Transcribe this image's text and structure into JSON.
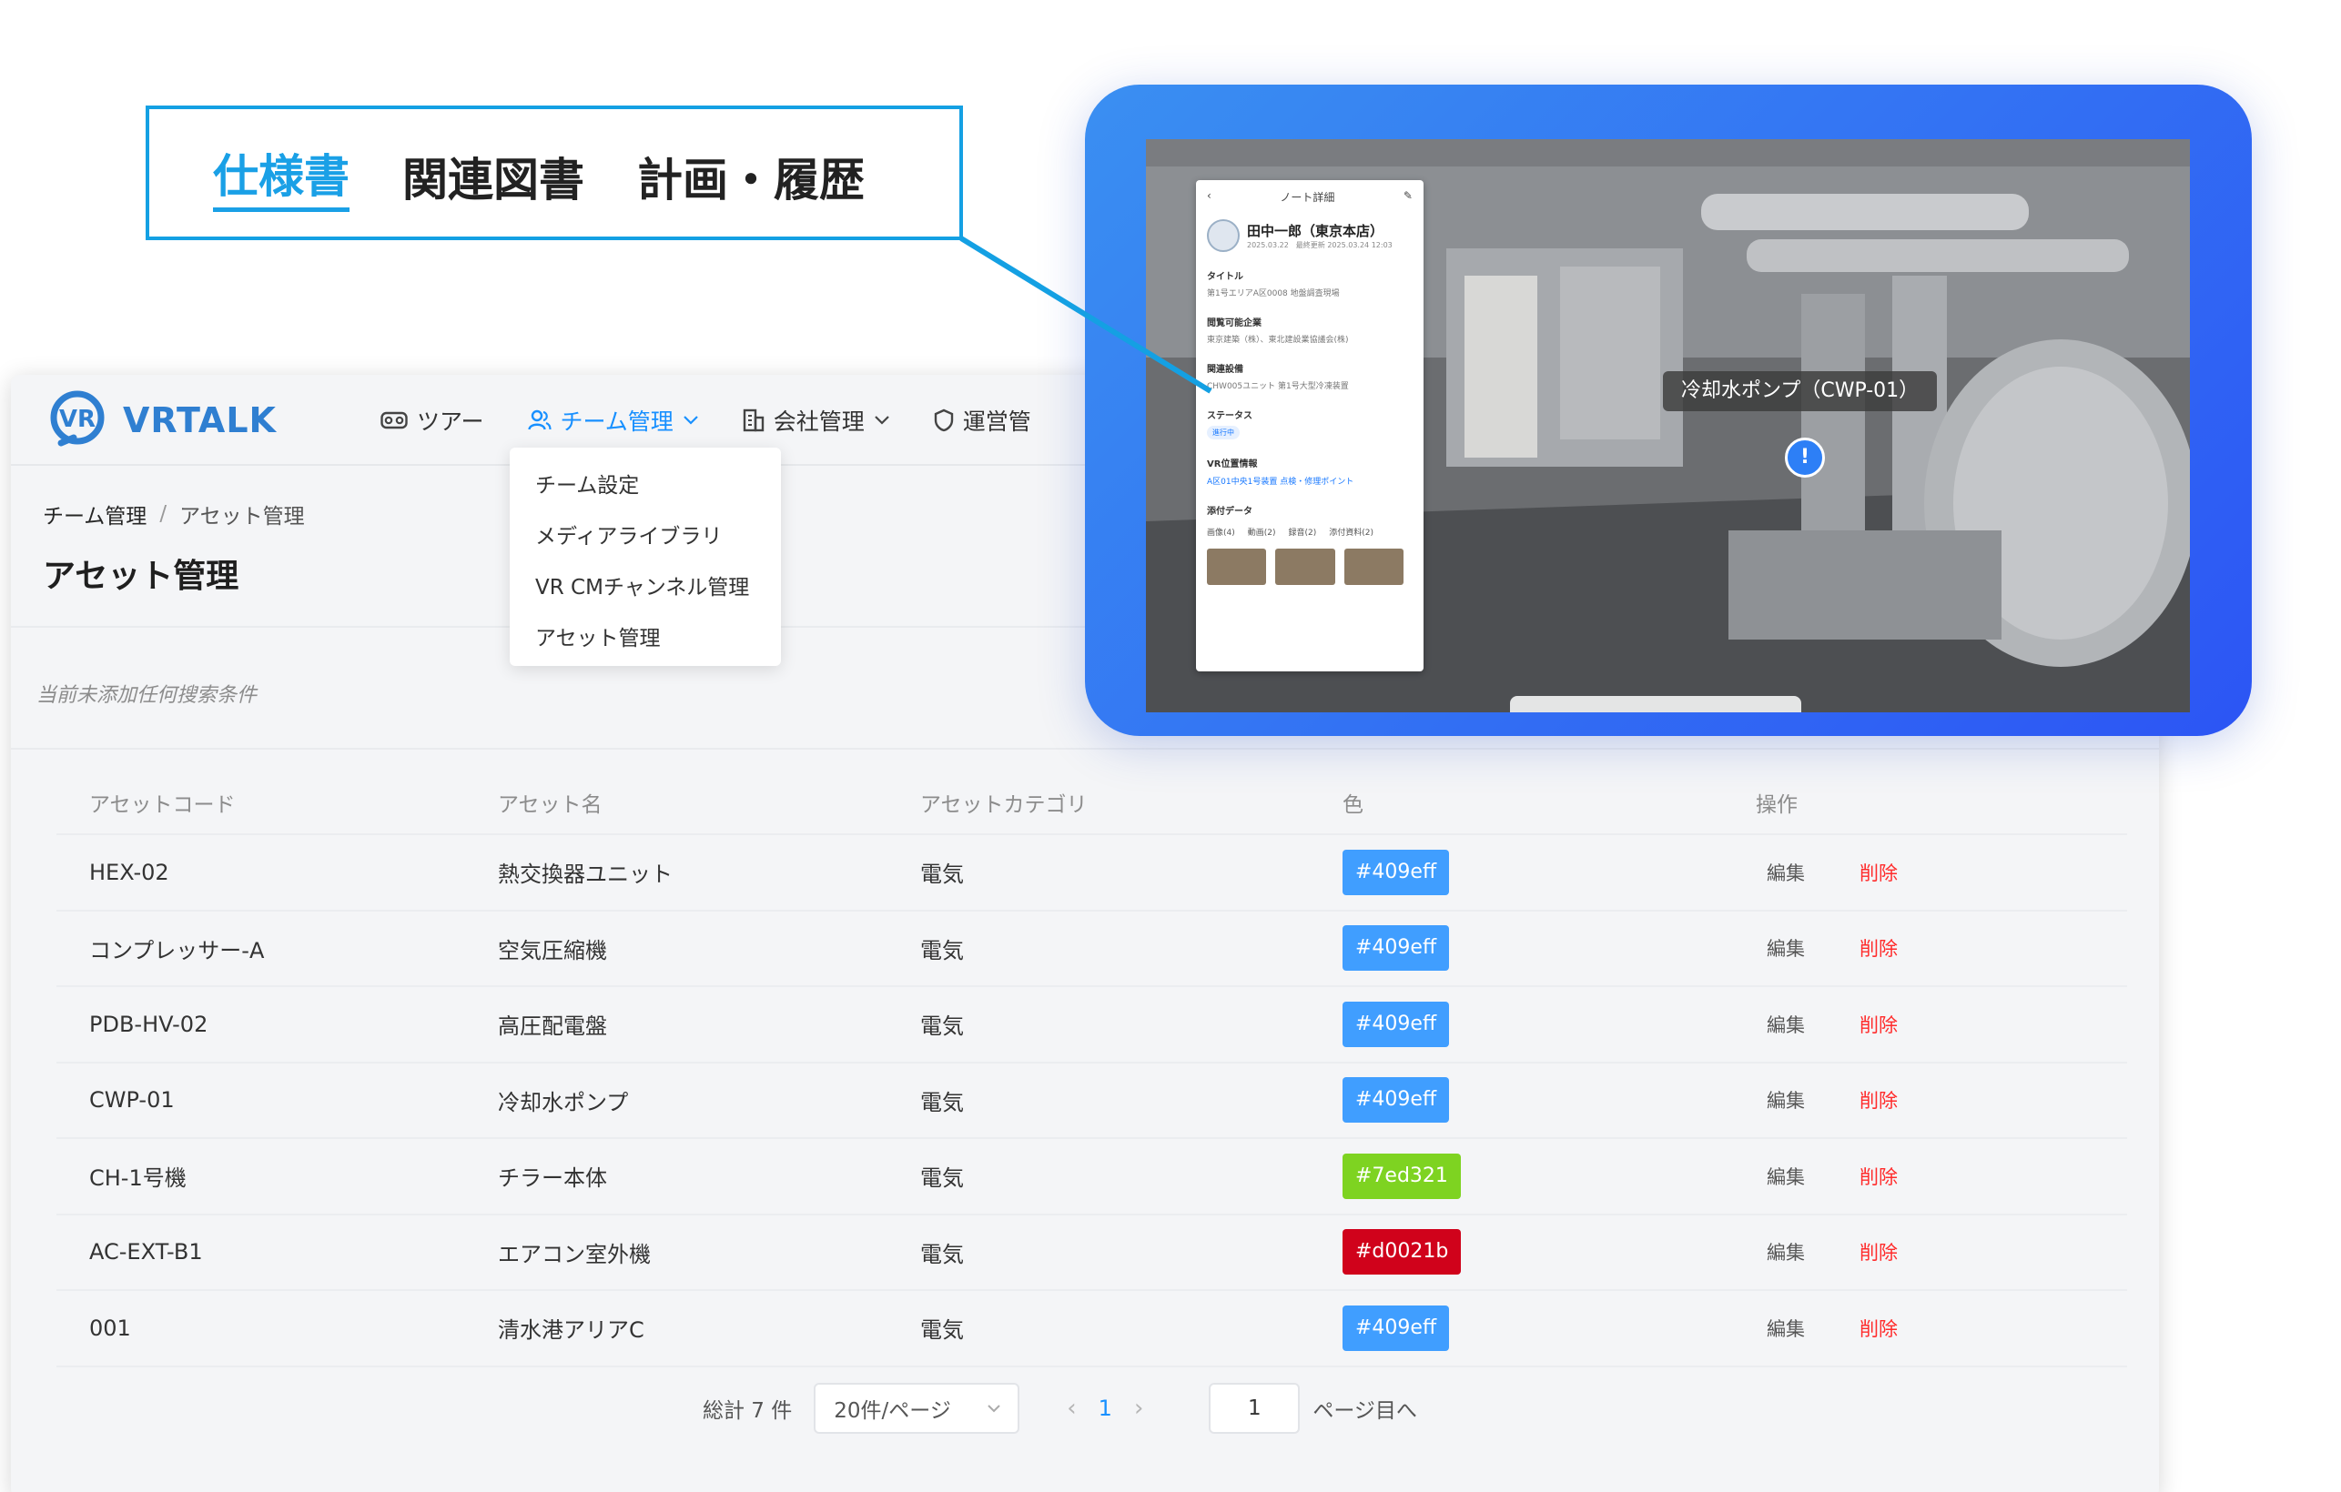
{
  "callout": {
    "tabs": [
      {
        "label": "仕様書",
        "active": true
      },
      {
        "label": "関連図書",
        "active": false
      },
      {
        "label": "計画・履歴",
        "active": false
      }
    ],
    "accent_color": "#14a0e3"
  },
  "header": {
    "logo": "VRTALK",
    "nav": [
      {
        "label": "ツアー",
        "icon": "vr-goggles-icon",
        "active": false
      },
      {
        "label": "チーム管理",
        "icon": "team-icon",
        "active": true
      },
      {
        "label": "会社管理",
        "icon": "building-icon",
        "active": false
      },
      {
        "label": "運営管",
        "icon": "shield-icon",
        "active": false
      }
    ]
  },
  "dropdown": {
    "items": [
      "チーム設定",
      "メディアライブラリ",
      "VR CMチャンネル管理",
      "アセット管理"
    ]
  },
  "breadcrumb": {
    "items": [
      "チーム管理",
      "アセット管理"
    ],
    "separator": "/"
  },
  "page": {
    "title": "アセット管理",
    "filter_empty_text": "当前未添加任何搜索条件"
  },
  "table": {
    "columns": [
      "アセットコード",
      "アセット名",
      "アセットカテゴリ",
      "色",
      "操作"
    ],
    "rows": [
      {
        "code": "HEX-02",
        "name": "熱交換器ユニット",
        "category": "電気",
        "color": "#409eff",
        "edit": "編集",
        "delete": "削除"
      },
      {
        "code": "コンプレッサー-A",
        "name": "空気圧縮機",
        "category": "電気",
        "color": "#409eff",
        "edit": "編集",
        "delete": "削除"
      },
      {
        "code": "PDB-HV-02",
        "name": "高圧配電盤",
        "category": "電気",
        "color": "#409eff",
        "edit": "編集",
        "delete": "削除"
      },
      {
        "code": "CWP-01",
        "name": "冷却水ポンプ",
        "category": "電気",
        "color": "#409eff",
        "edit": "編集",
        "delete": "削除"
      },
      {
        "code": "CH-1号機",
        "name": "チラー本体",
        "category": "電気",
        "color": "#7ed321",
        "edit": "編集",
        "delete": "削除"
      },
      {
        "code": "AC-EXT-B1",
        "name": "エアコン室外機",
        "category": "電気",
        "color": "#d0021b",
        "edit": "編集",
        "delete": "削除"
      },
      {
        "code": "001",
        "name": "清水港アリアC",
        "category": "電気",
        "color": "#409eff",
        "edit": "編集",
        "delete": "削除"
      }
    ]
  },
  "pagination": {
    "total": "総計 7 件",
    "page_size": "20件/ページ",
    "current_page": "1",
    "jump_value": "1",
    "jump_label": "ページ目へ"
  },
  "vr": {
    "asset_label": "冷却水ポンプ（CWP-01）",
    "hotspot_symbol": "!",
    "note": {
      "header": "ノート詳細",
      "user": "田中一郎（東京本店）",
      "date": "2025.03.22　最終更新 2025.03.24 12:03",
      "fields": [
        {
          "label": "タイトル",
          "value": "第1号エリアA区0008 地盤調査現場"
        },
        {
          "label": "閲覧可能企業",
          "value": "東京建築（株）、東北建設業協議会(株)"
        },
        {
          "label": "関連設備",
          "value": "CHW005ユニット 第1号大型冷凍装置"
        }
      ],
      "status_label": "ステータス",
      "status_value": "進行中",
      "location_label": "VR位置情報",
      "location_value": "A区01中央1号装置 点検・修理ポイント",
      "attach_label": "添付データ",
      "attach_tabs": [
        "画像(4)",
        "動画(2)",
        "録音(2)",
        "添付資料(2)"
      ]
    }
  }
}
